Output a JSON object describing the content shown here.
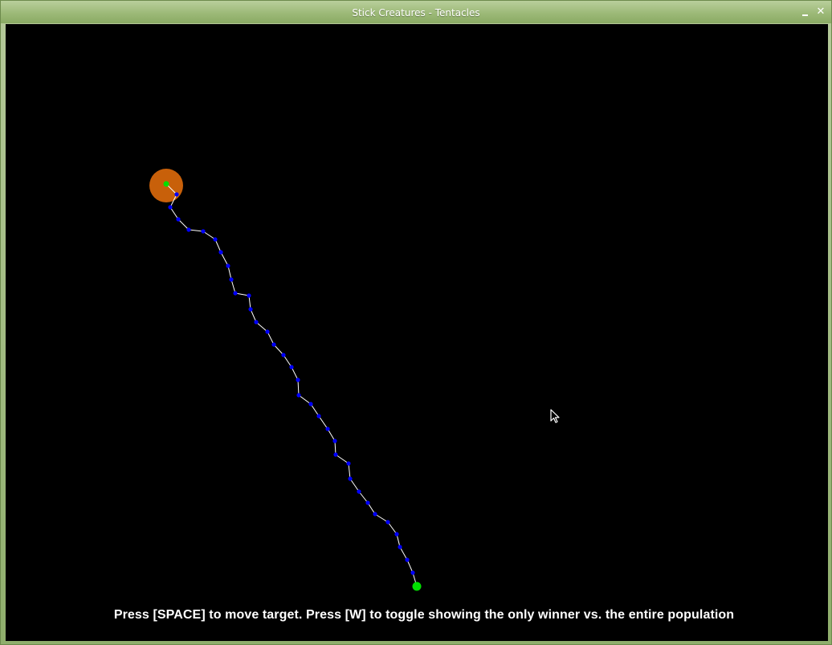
{
  "window": {
    "title": "Stick Creatures - Tentacles",
    "minimize_glyph": "minimize-icon",
    "close_glyph": "✕"
  },
  "scene": {
    "background": "#000000",
    "target_color": "#c8600a",
    "head_color": "#00e000",
    "joint_color": "#0000ff",
    "segment_color": "#ffffff",
    "base_color": "#00e000"
  },
  "instructions": "Press [SPACE] to move target.  Press [W] to toggle showing the only winner vs. the entire population",
  "icons": {
    "cursor": "mouse-pointer-icon"
  }
}
